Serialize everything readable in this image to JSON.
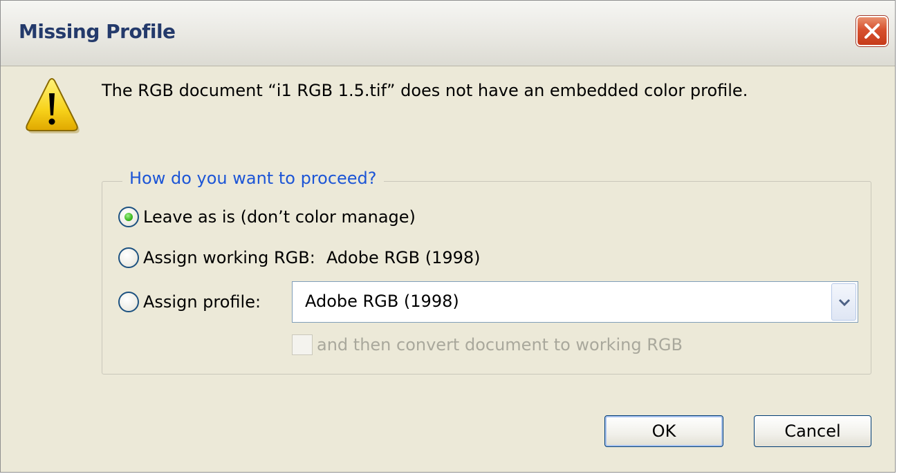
{
  "window": {
    "title": "Missing Profile"
  },
  "message": {
    "text": "The RGB document “i1 RGB 1.5.tif” does not have an embedded color profile.",
    "icon": "warning-icon"
  },
  "group": {
    "legend": "How do you want to proceed?",
    "options": [
      {
        "label": "Leave as is (don’t color manage)",
        "checked": true
      },
      {
        "label": "Assign working RGB:",
        "value": "Adobe RGB (1998)",
        "checked": false
      },
      {
        "label": "Assign profile:",
        "checked": false
      }
    ],
    "profile_select": {
      "selected": "Adobe RGB (1998)"
    },
    "convert_checkbox": {
      "label": "and then convert document to working RGB",
      "checked": false,
      "enabled": false
    }
  },
  "buttons": {
    "ok": "OK",
    "cancel": "Cancel"
  },
  "colors": {
    "legend": "#1c55d6",
    "title": "#243a6b",
    "dialog_bg": "#ece9d8",
    "close_red": "#d7512f",
    "radio_checked": "#3cb81f"
  }
}
